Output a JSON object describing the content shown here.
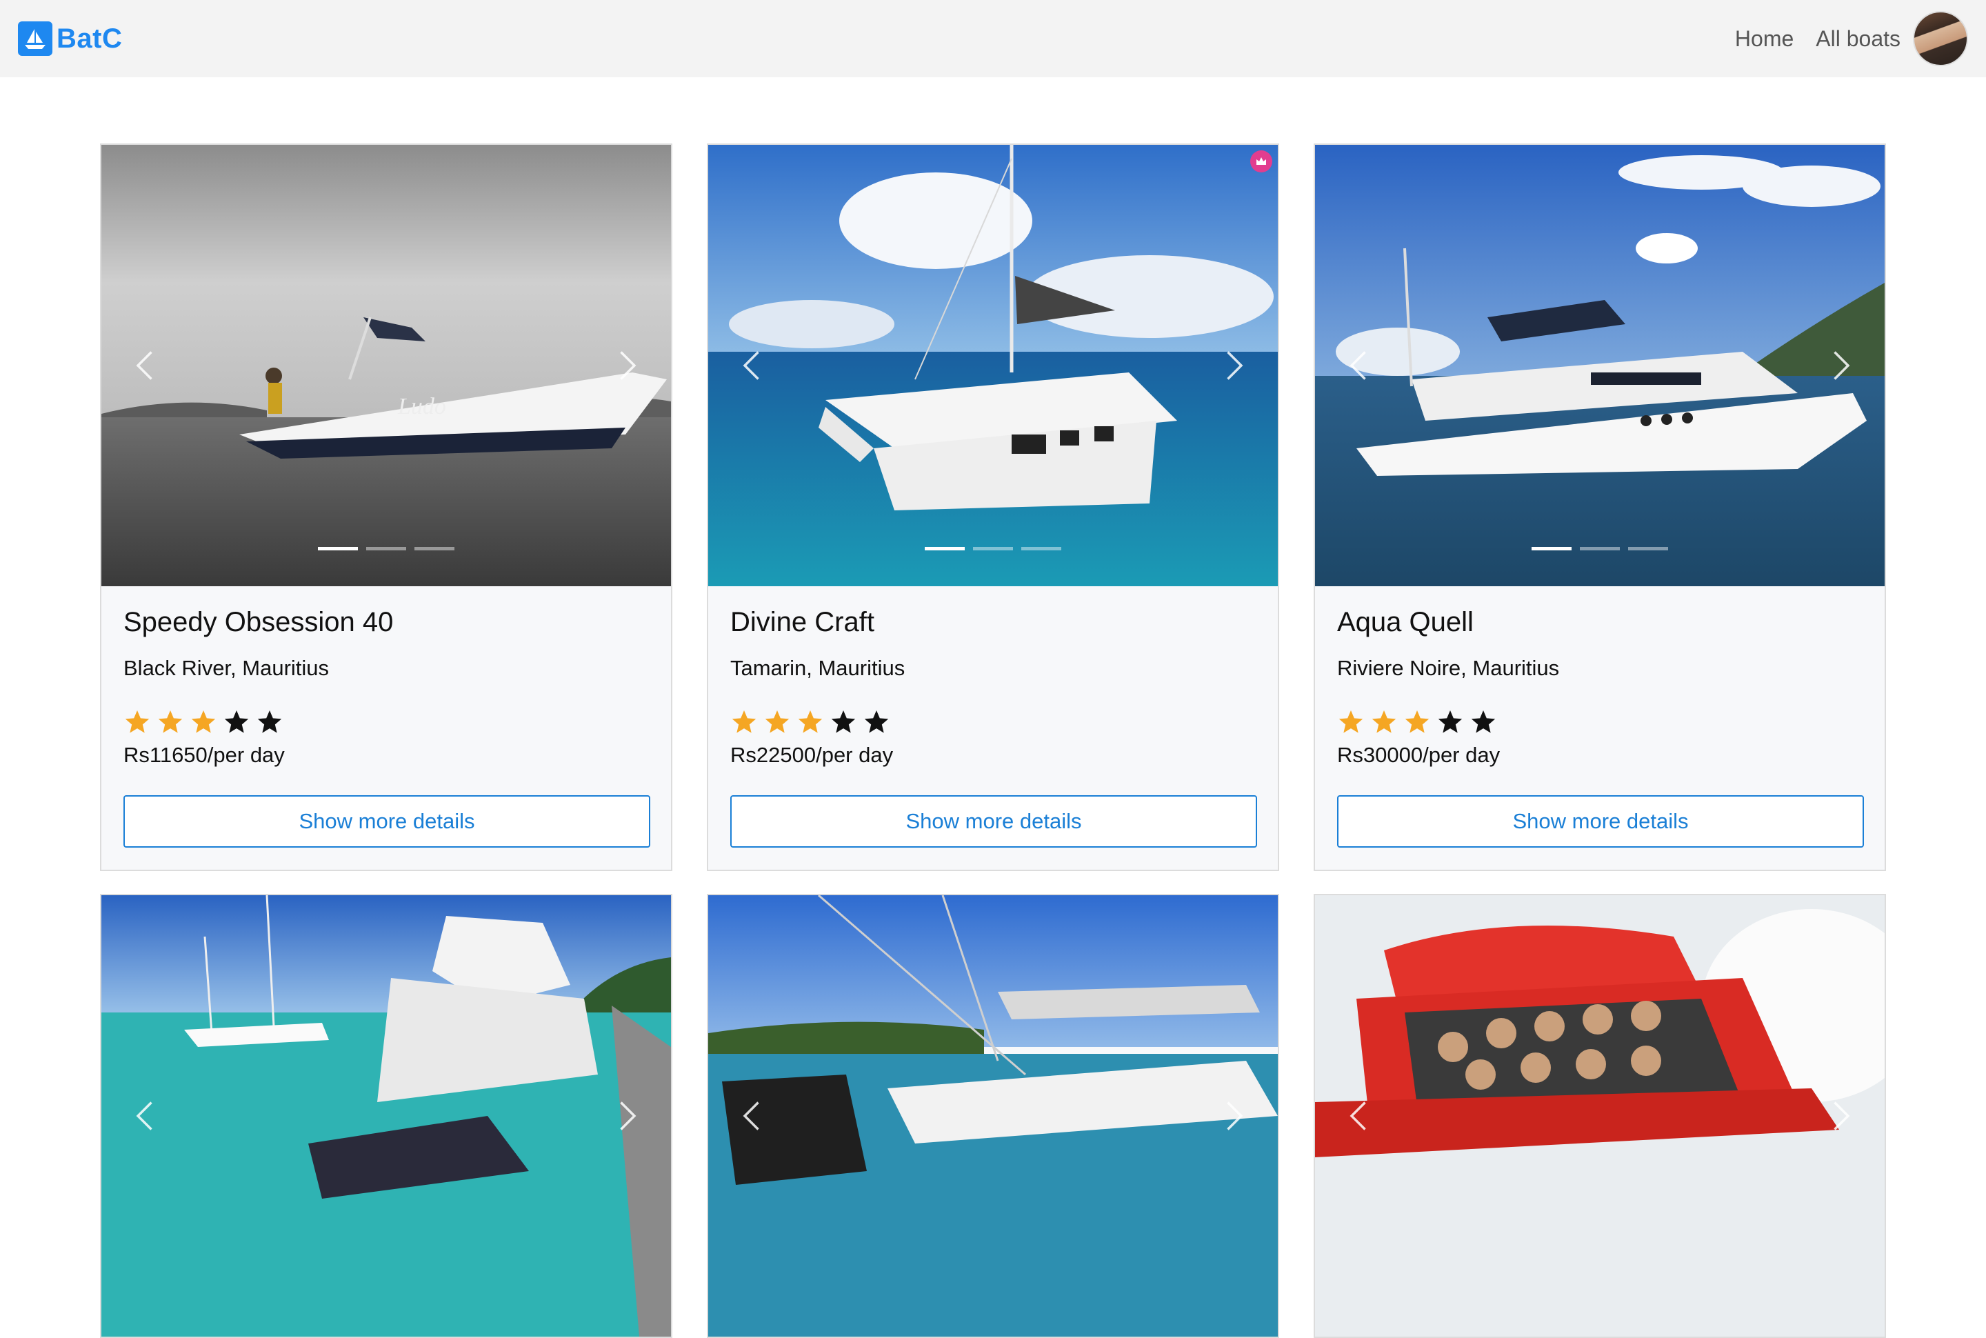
{
  "nav": {
    "brand": "BatC",
    "links": [
      "Home",
      "All boats"
    ]
  },
  "colors": {
    "brand": "#1e88f0",
    "star_filled": "#f5a623",
    "star_empty": "#111111",
    "button": "#1a7fd6",
    "premium_badge": "#e23d8f"
  },
  "boats": [
    {
      "title": "Speedy Obsession 40",
      "location": "Black River, Mauritius",
      "rating": 3,
      "rating_max": 5,
      "price": "Rs11650/per day",
      "button": "Show more details",
      "premium": false,
      "boat_name_on_hull": "Ludo"
    },
    {
      "title": "Divine Craft",
      "location": "Tamarin, Mauritius",
      "rating": 3,
      "rating_max": 5,
      "price": "Rs22500/per day",
      "button": "Show more details",
      "premium": true
    },
    {
      "title": "Aqua Quell",
      "location": "Riviere Noire, Mauritius",
      "rating": 3,
      "rating_max": 5,
      "price": "Rs30000/per day",
      "button": "Show more details",
      "premium": false
    },
    {
      "title": "",
      "location": "",
      "price": "",
      "button": "",
      "premium": false
    },
    {
      "title": "",
      "location": "",
      "price": "",
      "button": "",
      "premium": false
    },
    {
      "title": "",
      "location": "",
      "price": "",
      "button": "",
      "premium": false
    }
  ],
  "icons": {
    "prev": "chevron-left-icon",
    "next": "chevron-right-icon",
    "star": "star-icon",
    "premium": "crown-icon"
  }
}
